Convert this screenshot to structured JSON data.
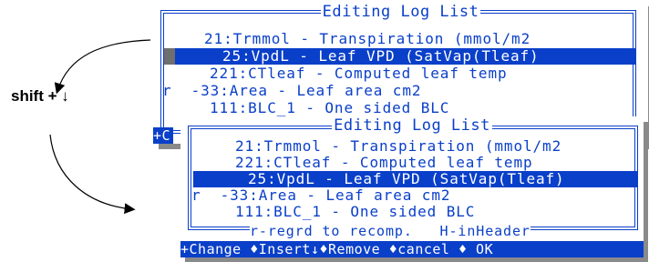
{
  "back_window": {
    "title": "Editing Log List",
    "rows": [
      {
        "prefix": "   ",
        "text": "21:Trmmol - Transpiration (mmol/m2",
        "selected": false
      },
      {
        "prefix": "   ",
        "text": "25:VpdL - Leaf VPD (SatVap(Tleaf)",
        "selected": true
      },
      {
        "prefix": "  ",
        "text": "221:CTleaf - Computed leaf temp",
        "selected": false
      },
      {
        "prefix": "r ",
        "text": "-33:Area - Leaf area cm2",
        "selected": false
      },
      {
        "prefix": "  ",
        "text": "111:BLC_1 - One sided BLC",
        "selected": false
      }
    ],
    "footer_fragment": "+C"
  },
  "front_window": {
    "title": "Editing Log List",
    "rows": [
      {
        "prefix": "   ",
        "text": "21:Trmmol - Transpiration (mmol/m2",
        "selected": false
      },
      {
        "prefix": "  ",
        "text": "221:CTleaf - Computed leaf temp",
        "selected": false
      },
      {
        "prefix": "   ",
        "text": "25:VpdL - Leaf VPD (SatVap(Tleaf)",
        "selected": true
      },
      {
        "prefix": "r ",
        "text": "-33:Area - Leaf area cm2",
        "selected": false
      },
      {
        "prefix": "  ",
        "text": "111:BLC_1 - One sided BLC",
        "selected": false
      }
    ],
    "hint": "r-regrd to recomp.   H-inHeader",
    "footer": "+Change ♦Insert↓♦Remove ♦cancel ♦ OK"
  },
  "annotation": {
    "label": "shift + ↓"
  },
  "colors": {
    "accent": "#0a3fc9",
    "shadow": "#8a8a8a"
  }
}
